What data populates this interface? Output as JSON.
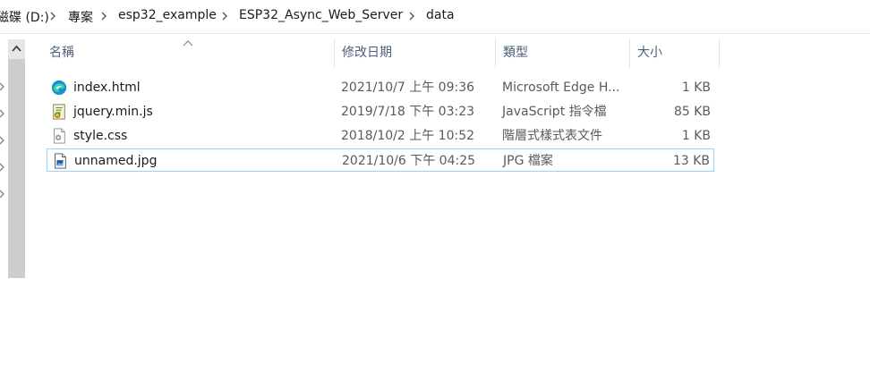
{
  "breadcrumb": {
    "items": [
      "磁碟 (D:)",
      "專案",
      "esp32_example",
      "ESP32_Async_Web_Server",
      "data"
    ]
  },
  "columns": {
    "name": "名稱",
    "date": "修改日期",
    "type": "類型",
    "size": "大小"
  },
  "files": [
    {
      "name": "index.html",
      "date": "2021/10/7 上午 09:36",
      "type": "Microsoft Edge H...",
      "size": "1 KB",
      "icon": "edge-icon"
    },
    {
      "name": "jquery.min.js",
      "date": "2019/7/18 下午 03:23",
      "type": "JavaScript 指令檔",
      "size": "85 KB",
      "icon": "script-file-icon"
    },
    {
      "name": "style.css",
      "date": "2018/10/2 上午 10:52",
      "type": "階層式樣式表文件",
      "size": "1 KB",
      "icon": "css-file-icon"
    },
    {
      "name": "unnamed.jpg",
      "date": "2021/10/6 下午 04:25",
      "type": "JPG 檔案",
      "size": "13 KB",
      "icon": "image-file-icon"
    }
  ],
  "selected_index": 3,
  "colors": {
    "selection_border": "#99d1ff",
    "header_text": "#4c607a"
  }
}
